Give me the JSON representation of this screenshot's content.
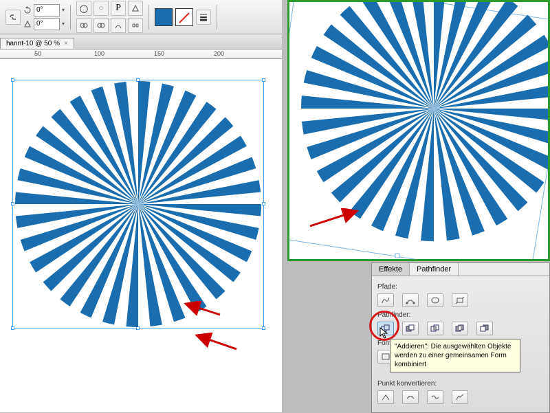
{
  "toolbar": {
    "angle1": "0°",
    "angle2": "0°"
  },
  "document": {
    "tab_title": "hannt-10 @ 50 %",
    "ruler_marks": [
      "50",
      "100",
      "150",
      "200"
    ]
  },
  "panel": {
    "tabs": {
      "effects": "Effekte",
      "pathfinder": "Pathfinder"
    },
    "section_paths": "Pfade:",
    "section_pathfinder": "Pathfinder:",
    "section_convert": "Form konvertieren:",
    "section_point": "Punkt konvertieren:",
    "tooltip": "\"Addieren\": Die ausgewählten Objekte werden zu einer gemeinsamen Form kombiniert"
  },
  "colors": {
    "accent": "#1a6eaf",
    "highlight": "#d61a1a",
    "preview_border": "#2a9c2a"
  }
}
